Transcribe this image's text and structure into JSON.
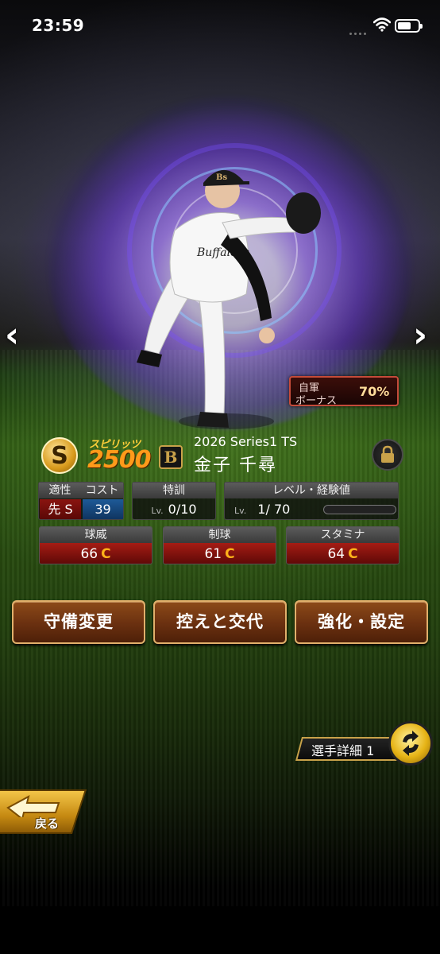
{
  "status_bar": {
    "time": "23:59"
  },
  "card": {
    "bonus_line1": "自軍",
    "bonus_line2": "ボーナス",
    "bonus_pct": "70%"
  },
  "player": {
    "spirit_label": "スピリッツ",
    "spirit_value": "2500",
    "team_logo": "B",
    "series": "2026 Series1 TS",
    "name": "金子 千尋"
  },
  "stats": {
    "aptitude_header": "適性",
    "aptitude_value": "先 S",
    "cost_header": "コスト",
    "cost_value": "39",
    "training_header": "特訓",
    "training_lv_prefix": "Lv.",
    "training_value": "0/10",
    "level_header": "レベル・経験値",
    "level_lv_prefix": "Lv.",
    "level_value": "1/ 70",
    "exp_fraction": 0,
    "velocity_header": "球威",
    "velocity_value": "66",
    "velocity_grade": "C",
    "control_header": "制球",
    "control_value": "61",
    "control_grade": "C",
    "stamina_header": "スタミナ",
    "stamina_value": "64",
    "stamina_grade": "C"
  },
  "actions": {
    "defense_change": "守備変更",
    "bench_swap": "控えと交代",
    "enhance_settings": "強化・設定"
  },
  "detail": {
    "label": "選手詳細 1"
  },
  "nav": {
    "back_label": "戻る"
  },
  "colors": {
    "accent_gold": "#c9a24a",
    "stat_red": "#a51c14",
    "grade_orange": "#ffb21a",
    "button_brown": "#6a3010"
  }
}
